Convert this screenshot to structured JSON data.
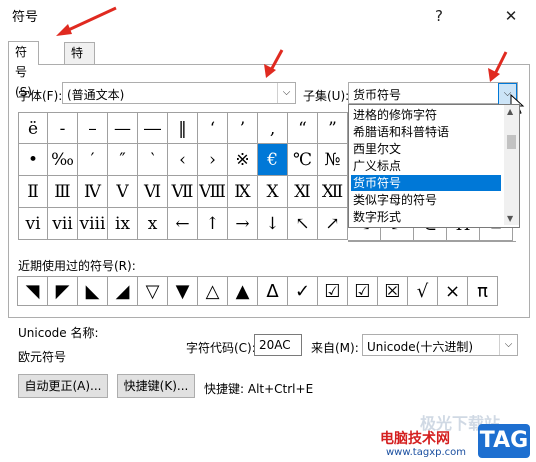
{
  "window": {
    "title": "符号",
    "help_label": "?",
    "close_label": "✕"
  },
  "tabs": [
    {
      "label": "符号(S)"
    },
    {
      "label": "特殊字符(P)"
    }
  ],
  "font": {
    "label": "字体(F):",
    "value": "(普通文本)"
  },
  "subset": {
    "label": "子集(U):",
    "value": "货币符号"
  },
  "subset_list": {
    "items": [
      "进格的修饰字符",
      "希腊语和科普特语",
      "西里尔文",
      "广义标点",
      "货币符号",
      "类似字母的符号",
      "数字形式"
    ],
    "selected_index": 4
  },
  "symbol_grid": {
    "rows": [
      [
        "ë",
        "-",
        "–",
        "—",
        "―",
        "‖",
        "‘",
        "’",
        "‚",
        "“",
        "”"
      ],
      [
        "•",
        "‰",
        "′",
        "″",
        "‵",
        "‹",
        "›",
        "※",
        "€",
        "℃",
        "№"
      ],
      [
        "Ⅱ",
        "Ⅲ",
        "Ⅳ",
        "Ⅴ",
        "Ⅵ",
        "Ⅶ",
        "Ⅷ",
        "Ⅸ",
        "Ⅹ",
        "Ⅺ",
        "Ⅻ"
      ],
      [
        "ⅵ",
        "ⅶ",
        "ⅷ",
        "ⅸ",
        "ⅹ",
        "←",
        "↑",
        "→",
        "↓",
        "↖",
        "↗"
      ]
    ],
    "right_peek_row3": [
      "↘",
      "↙",
      "⊂",
      "Π",
      "∠"
    ],
    "selected": "€"
  },
  "recent": {
    "label": "近期使用过的符号(R):",
    "symbols": [
      "◥",
      "◤",
      "◣",
      "◢",
      "▽",
      "▼",
      "△",
      "▲",
      "Δ",
      "✓",
      "☑",
      "☑",
      "☒",
      "√",
      "×",
      "π"
    ]
  },
  "info": {
    "unicode_name_label": "Unicode 名称:",
    "unicode_name": "欧元符号",
    "char_code_label": "字符代码(C):",
    "char_code": "20AC",
    "from_label": "来自(M):",
    "from_value": "Unicode(十六进制)"
  },
  "buttons": {
    "autocorrect": "自动更正(A)...",
    "shortcut_key": "快捷键(K)...",
    "shortcut_text": "快捷键: Alt+Ctrl+E"
  },
  "watermark": {
    "top": "极光下载站",
    "brand": "电脑技术网",
    "url": "www.tagxp.com",
    "tag": "TAG"
  },
  "colors": {
    "selection": "#0078d7",
    "arrow": "#e02a20"
  }
}
